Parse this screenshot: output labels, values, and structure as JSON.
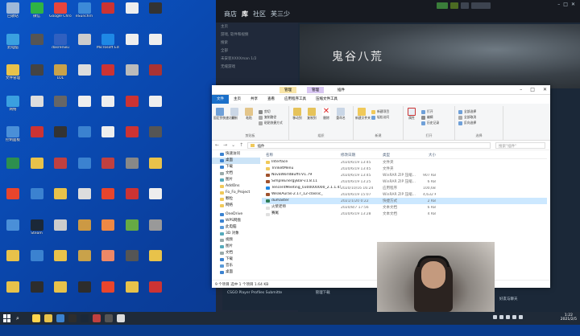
{
  "desktop": {
    "icons": [
      {
        "label": "回收站",
        "color": "#9fb8d8"
      },
      {
        "label": "微信",
        "color": "#2fb344"
      },
      {
        "label": "Google Chrome",
        "color": "#e8453c"
      },
      {
        "label": "eSunchrn",
        "color": "#3c8ad8"
      },
      {
        "label": "",
        "color": "#c33"
      },
      {
        "label": "",
        "color": "#eee"
      },
      {
        "label": "",
        "color": "#333"
      },
      {
        "label": "此电脑",
        "color": "#3aa0e0"
      },
      {
        "label": "",
        "color": "#555"
      },
      {
        "label": "dasrenwu",
        "color": "#3060c0"
      },
      {
        "label": "",
        "color": "#ccc"
      },
      {
        "label": "Microsoft Edge",
        "color": "#1e88e5"
      },
      {
        "label": "",
        "color": "#eee"
      },
      {
        "label": "",
        "color": "#eee"
      },
      {
        "label": "文件管理",
        "color": "#e8c24a"
      },
      {
        "label": "",
        "color": "#444"
      },
      {
        "label": "LOL",
        "color": "#c9a24a"
      },
      {
        "label": "",
        "color": "#ddd"
      },
      {
        "label": "",
        "color": "#c33"
      },
      {
        "label": "",
        "color": "#bbb"
      },
      {
        "label": "",
        "color": "#a33"
      },
      {
        "label": "网络",
        "color": "#3aa0e0"
      },
      {
        "label": "",
        "color": "#ddd"
      },
      {
        "label": "",
        "color": "#666"
      },
      {
        "label": "",
        "color": "#eee"
      },
      {
        "label": "",
        "color": "#eee"
      },
      {
        "label": "",
        "color": "#c33"
      },
      {
        "label": "",
        "color": "#eee"
      },
      {
        "label": "控制面板",
        "color": "#4a8fd8"
      },
      {
        "label": "",
        "color": "#c33"
      },
      {
        "label": "",
        "color": "#333"
      },
      {
        "label": "",
        "color": "#3b82d0"
      },
      {
        "label": "",
        "color": "#eee"
      },
      {
        "label": "",
        "color": "#c33"
      },
      {
        "label": "",
        "color": "#555"
      },
      {
        "label": "",
        "color": "#2d8f4e"
      },
      {
        "label": "",
        "color": "#e8c24a"
      },
      {
        "label": "",
        "color": "#c04040"
      },
      {
        "label": "",
        "color": "#3b82d0"
      },
      {
        "label": "",
        "color": "#c04040"
      },
      {
        "label": "",
        "color": "#888"
      },
      {
        "label": "",
        "color": "#e8c24a"
      },
      {
        "label": "",
        "color": "#e8452c"
      },
      {
        "label": "",
        "color": "#3b82d0"
      },
      {
        "label": "",
        "color": "#e8c24a"
      },
      {
        "label": "",
        "color": "#ddd"
      },
      {
        "label": "",
        "color": "#e8452c"
      },
      {
        "label": "",
        "color": "#c33"
      },
      {
        "label": "",
        "color": "#eee"
      },
      {
        "label": "",
        "color": "#4a8fd8"
      },
      {
        "label": "Steam",
        "color": "#1b2838"
      },
      {
        "label": "",
        "color": "#ccc"
      },
      {
        "label": "",
        "color": "#c94"
      },
      {
        "label": "",
        "color": "#e84"
      },
      {
        "label": "",
        "color": "#6a4"
      },
      {
        "label": "",
        "color": "#999"
      },
      {
        "label": "",
        "color": "#e8c24a"
      },
      {
        "label": "",
        "color": "#3b82d0"
      },
      {
        "label": "",
        "color": "#e8c24a"
      },
      {
        "label": "",
        "color": "#c9a24a"
      },
      {
        "label": "",
        "color": "#e86"
      },
      {
        "label": "",
        "color": "#555"
      },
      {
        "label": "",
        "color": "#e8c24a"
      },
      {
        "label": "",
        "color": "#e8c24a"
      },
      {
        "label": "",
        "color": "#2d2d2d"
      },
      {
        "label": "",
        "color": "#e8c24a"
      },
      {
        "label": "",
        "color": "#2d2d2d"
      },
      {
        "label": "",
        "color": "#e8452c"
      },
      {
        "label": "",
        "color": "#e8c24a"
      },
      {
        "label": "",
        "color": "#c33"
      },
      {
        "label": "",
        "color": "#e8452c"
      },
      {
        "label": "",
        "color": "#3b82d0"
      },
      {
        "label": "",
        "color": "#eee"
      },
      {
        "label": "",
        "color": "#3b82d0"
      },
      {
        "label": "",
        "color": "#666"
      },
      {
        "label": "",
        "color": "#eee"
      }
    ]
  },
  "steam": {
    "nav": [
      "商店",
      "库",
      "社区",
      "芙三少"
    ],
    "badges": [
      "",
      "",
      "",
      ""
    ],
    "sidebar": [
      "主页",
      "游戏, 软件和视频",
      "搜索",
      "全部",
      "未安装XXXXman 1/2",
      "无缝游戏"
    ],
    "banner_title": "鬼谷八荒",
    "bottom_items": [
      "CSGO Player Profiles Submitte",
      "管理下载",
      "好友与聊天"
    ]
  },
  "explorer": {
    "ctx_tabs": [
      "管理",
      "管理"
    ],
    "title": "插件",
    "tabs": [
      "文件",
      "主页",
      "共享",
      "查看",
      "应用程序工具",
      "压缩文件工具"
    ],
    "ribbon_groups": [
      "剪贴板",
      "组织",
      "新建",
      "打开",
      "选择"
    ],
    "ribbon": {
      "pin": "固定到快速访问",
      "copy": "复制",
      "paste": "粘贴",
      "cut": "剪切",
      "copy_path": "复制路径",
      "paste_shortcut": "粘贴快捷方式",
      "move_to": "移动到",
      "copy_to": "复制到",
      "delete": "删除",
      "rename": "重命名",
      "new_folder": "新建文件夹",
      "new_item": "新建项目",
      "easy_access": "轻松访问",
      "properties": "属性",
      "open": "打开",
      "edit": "编辑",
      "history": "历史记录",
      "select_all": "全部选择",
      "select_none": "全部取消",
      "invert": "反向选择"
    },
    "path": "插件",
    "search_placeholder": "搜索\"插件\"",
    "nav_items": [
      "快速访问",
      "桌面",
      "下载",
      "文档",
      "图片",
      "AddOns",
      "Fo_Fo_Project",
      "颗粒",
      "网络",
      "OneDrive",
      "WPS网盘",
      "此电脑",
      "3D 对象",
      "视频",
      "图片",
      "文档",
      "下载",
      "音乐",
      "桌面"
    ],
    "columns": [
      "名称",
      "修改日期",
      "类型",
      "大小"
    ],
    "rows": [
      {
        "name": "Interface",
        "date": "2020/6/19 13:45",
        "type": "文件夹",
        "size": "",
        "kind": "folder"
      },
      {
        "name": "TrinketMenu",
        "date": "2020/6/19 13:45",
        "type": "文件夹",
        "size": "",
        "kind": "folder"
      },
      {
        "name": "NovaWorldBuffs-V1.79",
        "date": "2020/6/19 13:45",
        "type": "WinRAR ZIP 压缩...",
        "size": "907 KB",
        "kind": "zip"
      },
      {
        "name": "SimpleEnergyBar-v1.8.11",
        "date": "2020/6/19 13:25",
        "type": "WinRAR ZIP 压缩...",
        "size": "6 KB",
        "kind": "zip"
      },
      {
        "name": "TencentMeeting_0300000000_2.1.1.45...",
        "date": "2020/10/16 16:24",
        "type": "应用程序",
        "size": "100,689 KB",
        "kind": "app"
      },
      {
        "name": "WeakAuras-2.17_12-classic_",
        "date": "2020/6/19 15:07",
        "type": "WinRAR ZIP 压缩...",
        "size": "4,632 KB",
        "kind": "zip"
      },
      {
        "name": "dumaster",
        "date": "2021/1/20 0:22",
        "type": "快捷方式",
        "size": "2 KB",
        "kind": "lnk"
      },
      {
        "name": "火柴老师",
        "date": "2020/8/7 17:56",
        "type": "文本文档",
        "size": "6 KB",
        "kind": "txt"
      },
      {
        "name": "赛尾",
        "date": "2020/6/19 13:28",
        "type": "文本文档",
        "size": "4 KB",
        "kind": "txt"
      }
    ],
    "status": "9 个项目   选中 1 个项目  1.64 KB"
  },
  "taskbar": {
    "search_icon": "search-icon",
    "time": "1:22",
    "date": "2021/2/5",
    "app_colors": [
      "#ffd44d",
      "#e8c24a",
      "#3b82d0",
      "#2d2d2d",
      "#1b2838",
      "#c04040",
      "#555",
      "#ddd"
    ]
  }
}
